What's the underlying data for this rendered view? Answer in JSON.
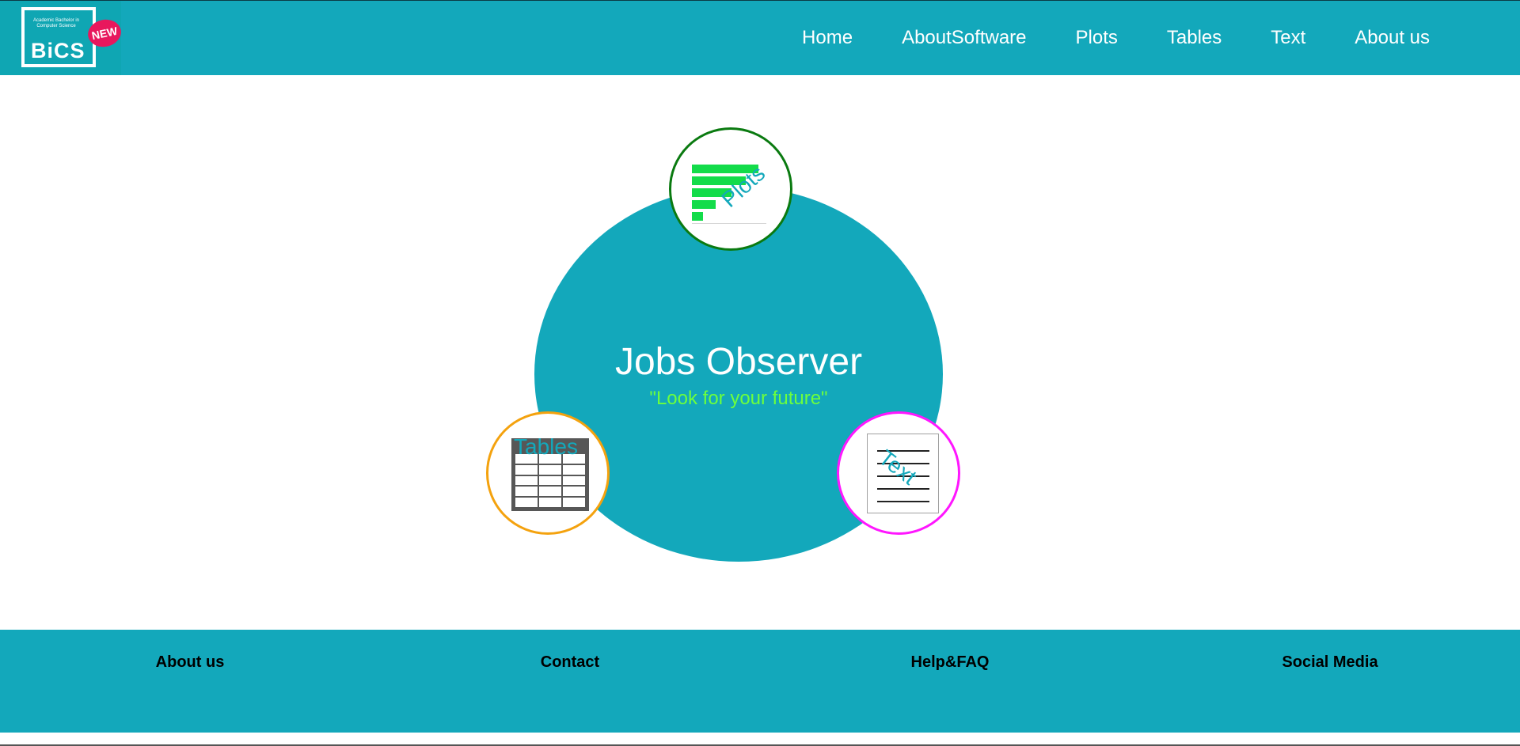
{
  "logo": {
    "small_text": "Academic Bachelor in Computer Science",
    "main_text": "BiCS",
    "badge": "NEW"
  },
  "nav": {
    "items": [
      "Home",
      "AboutSoftware",
      "Plots",
      "Tables",
      "Text",
      "About us"
    ]
  },
  "hero": {
    "title": "Jobs Observer",
    "subtitle": "\"Look for your future\""
  },
  "bubbles": {
    "plots": "Plots",
    "tables": "Tables",
    "text": "Text"
  },
  "footer": {
    "links": [
      "About us",
      "Contact",
      "Help&FAQ",
      "Social Media"
    ]
  },
  "colors": {
    "brand": "#13a8bb",
    "subtitle": "#6cff3d",
    "plots_border": "#0a7a10",
    "tables_border": "#f4a20e",
    "text_border": "#ff16ff"
  }
}
